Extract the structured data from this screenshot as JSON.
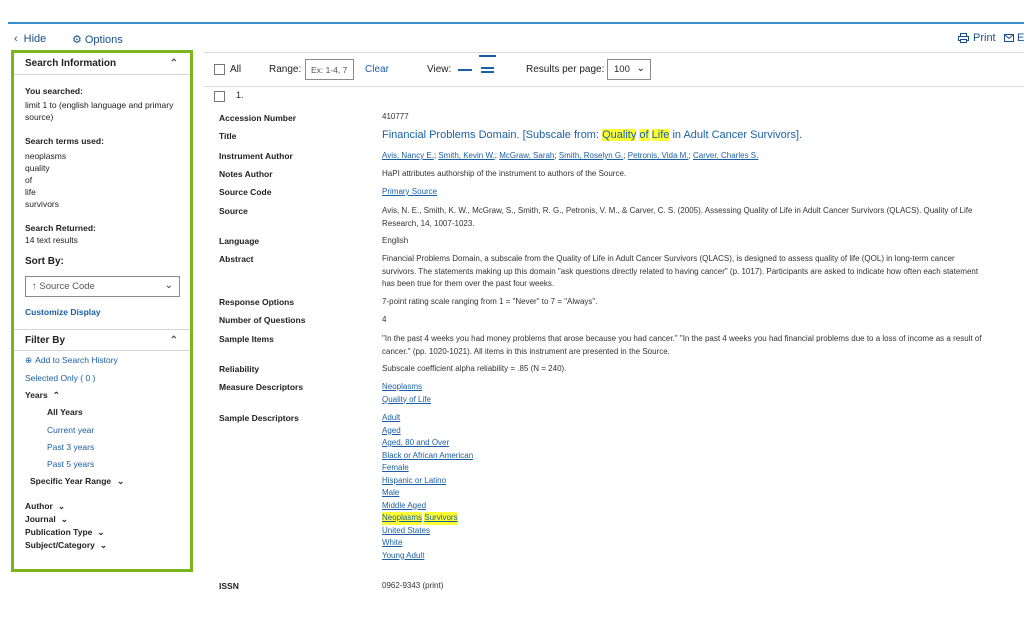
{
  "toolbar": {
    "hide_label": "Hide",
    "options_label": "Options",
    "print_label": "Print",
    "email_label": "E"
  },
  "sidebar": {
    "search_info_title": "Search Information",
    "you_searched_label": "You searched:",
    "you_searched_value_line1": "limit 1 to (english language and primary",
    "you_searched_value_line2": "source)",
    "terms_label": "Search terms used:",
    "terms": [
      "neoplasms",
      "quality",
      "of",
      "life",
      "survivors"
    ],
    "returned_label": "Search Returned:",
    "returned_value": "14 text results",
    "sort_by_label": "Sort By:",
    "sort_by_value": "↑ Source Code",
    "customize_display": "Customize Display",
    "filter_by_title": "Filter By",
    "add_to_history": "Add to Search History",
    "selected_only": "Selected Only ( 0 )",
    "years_label": "Years",
    "year_options": [
      "All Years",
      "Current year",
      "Past 3 years",
      "Past 5 years"
    ],
    "specific_year_range": "Specific Year Range",
    "facets": [
      "Author",
      "Journal",
      "Publication Type",
      "Subject/Category"
    ]
  },
  "main_toolbar": {
    "all_label": "All",
    "range_label": "Range:",
    "range_placeholder": "Ex: 1-4, 7",
    "clear_label": "Clear",
    "view_label": "View:",
    "rpp_label": "Results per page:",
    "rpp_value": "100"
  },
  "record": {
    "number": "1.",
    "labels": {
      "accession": "Accession Number",
      "title": "Title",
      "instrument_author": "Instrument Author",
      "notes_author": "Notes Author",
      "source_code": "Source Code",
      "source": "Source",
      "language": "Language",
      "abstract": "Abstract",
      "response_options": "Response Options",
      "num_questions": "Number of Questions",
      "sample_items": "Sample Items",
      "reliability": "Reliability",
      "measure_descriptors": "Measure Descriptors",
      "sample_descriptors": "Sample Descriptors",
      "issn": "ISSN"
    },
    "accession": "410777",
    "title_parts": [
      "Financial Problems Domain. [Subscale from: ",
      "Quality",
      " ",
      "of",
      " ",
      "Life",
      " in Adult Cancer Survivors]."
    ],
    "authors": [
      "Avis, Nancy E.",
      "Smith, Kevin W.",
      "McGraw, Sarah",
      "Smith, Roselyn G.",
      "Petronis, Vida M.",
      "Carver, Charles S."
    ],
    "notes_author": "HaPI attributes authorship of the instrument to authors of the Source.",
    "source_code": "Primary Source",
    "source_line1": "Avis, N. E., Smith, K. W., McGraw, S., Smith, R. G., Petronis, V. M., & Carver, C. S. (2005). Assessing Quality of Life in Adult Cancer Survivors (QLACS). Quality of Life",
    "source_line2": "Research, 14, 1007-1023.",
    "language": "English",
    "abstract_line1": "Financial Problems Domain, a subscale from the Quality of Life in Adult Cancer Survivors (QLACS), is designed to assess quality of life (QOL) in long-term cancer",
    "abstract_line2": "survivors. The statements making up this domain \"ask questions directly related to having cancer\" (p. 1017). Participants are asked to indicate how often each statement",
    "abstract_line3": "has been true for them over the past four weeks.",
    "response_options": "7-point rating scale ranging from 1 = \"Never\" to 7 = \"Always\".",
    "num_questions": "4",
    "sample_items_line1": "\"In the past 4 weeks you had money problems that arose because you had cancer.\" \"In the past 4 weeks you had financial problems due to a loss of income as a result of",
    "sample_items_line2": "cancer.\" (pp. 1020-1021). All items in this instrument are presented in the Source.",
    "reliability": "Subscale coefficient alpha reliability = .85 (N = 240).",
    "measure_descriptors": [
      "Neoplasms",
      "Quality of Life"
    ],
    "sample_descriptors": [
      "Adult",
      "Aged",
      "Aged, 80 and Over",
      "Black or African American",
      "Female",
      "Hispanic or Latino",
      "Male",
      "Middle Aged",
      "Neoplasms",
      "Survivors",
      "United States",
      "White",
      "Young Adult"
    ],
    "highlighted_descriptors": [
      "Neoplasms",
      "Survivors"
    ],
    "issn": "0962-9343 (print)"
  }
}
